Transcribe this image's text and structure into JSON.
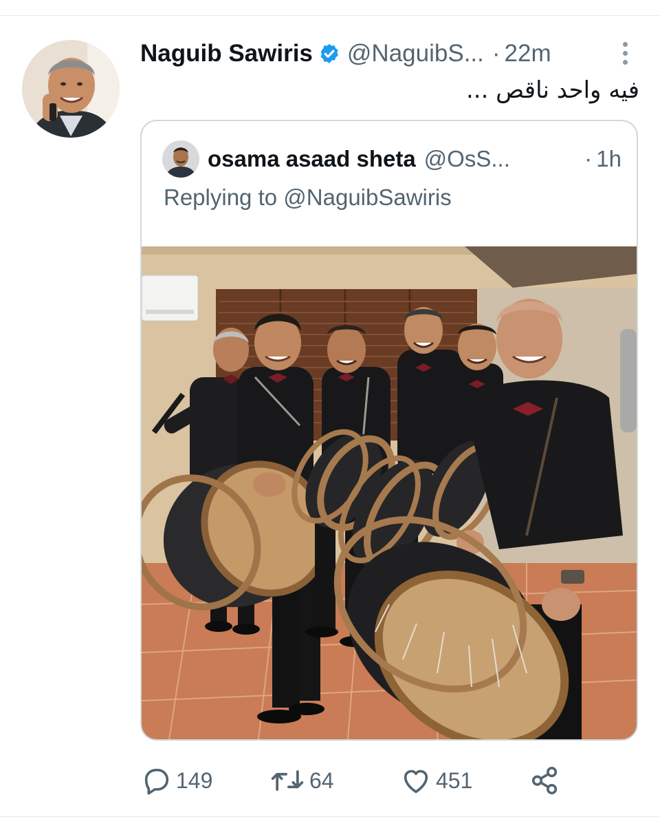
{
  "tweet": {
    "author_name": "Naguib Sawiris",
    "handle": "@NaguibS...",
    "separator": "·",
    "time": "22m",
    "text": "فيه واحد ناقص ..."
  },
  "quoted_tweet": {
    "author_name": "osama asaad sheta",
    "handle": "@OsS...",
    "separator": "·",
    "time": "1h",
    "replying_prefix": "Replying to",
    "replying_handle": "@NaguibSawiris"
  },
  "actions": {
    "reply_count": "149",
    "retweet_count": "64",
    "like_count": "451"
  },
  "icons": {
    "verified": "verified-badge-icon",
    "more": "more-vertical-icon",
    "reply": "reply-icon",
    "retweet": "retweet-icon",
    "like": "heart-icon",
    "share": "share-icon"
  },
  "colors": {
    "verified_blue": "#1d9bf0",
    "secondary_text": "#536471",
    "border": "#cfd9de"
  }
}
